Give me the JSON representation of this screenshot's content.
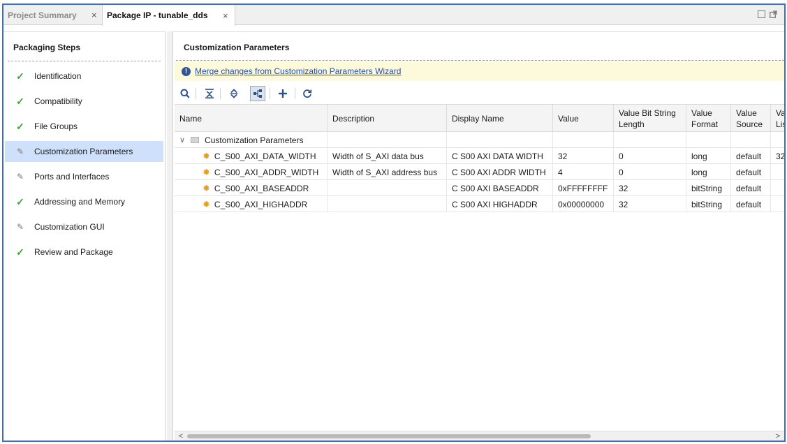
{
  "tabs": [
    {
      "label": "Project Summary",
      "close": "×"
    },
    {
      "label": "Package IP - tunable_dds",
      "close": "×"
    }
  ],
  "window_controls": {
    "maximize_icon": "maximize-icon",
    "float_icon": "float-icon"
  },
  "left_panel": {
    "title": "Packaging Steps",
    "steps": [
      {
        "label": "Identification",
        "status": "complete"
      },
      {
        "label": "Compatibility",
        "status": "complete"
      },
      {
        "label": "File Groups",
        "status": "complete"
      },
      {
        "label": "Customization Parameters",
        "status": "edited",
        "selected": true
      },
      {
        "label": "Ports and Interfaces",
        "status": "edited"
      },
      {
        "label": "Addressing and Memory",
        "status": "complete"
      },
      {
        "label": "Customization GUI",
        "status": "edited"
      },
      {
        "label": "Review and Package",
        "status": "complete"
      }
    ]
  },
  "main": {
    "title": "Customization Parameters",
    "banner_link": "Merge changes from Customization Parameters Wizard",
    "toolbar": [
      "search-icon",
      "collapse-all-icon",
      "expand-all-icon",
      "hierarchy-icon",
      "add-icon",
      "refresh-icon"
    ],
    "table": {
      "columns": [
        "Name",
        "Description",
        "Display Name",
        "Value",
        "Value Bit String Length",
        "Value Format",
        "Value Source",
        "Va Lis"
      ],
      "group": "Customization Parameters",
      "rows": [
        [
          "C_S00_AXI_DATA_WIDTH",
          "Width of S_AXI data bus",
          "C S00 AXI DATA WIDTH",
          "32",
          "0",
          "long",
          "default",
          "32"
        ],
        [
          "C_S00_AXI_ADDR_WIDTH",
          "Width of S_AXI address bus",
          "C S00 AXI ADDR WIDTH",
          "4",
          "0",
          "long",
          "default",
          ""
        ],
        [
          "C_S00_AXI_BASEADDR",
          "",
          "C S00 AXI BASEADDR",
          "0xFFFFFFFF",
          "32",
          "bitString",
          "default",
          ""
        ],
        [
          "C_S00_AXI_HIGHADDR",
          "",
          "C S00 AXI HIGHADDR",
          "0x00000000",
          "32",
          "bitString",
          "default",
          ""
        ]
      ]
    }
  },
  "colors": {
    "frame": "#3b6fc4",
    "selected": "#cfe0fb",
    "banner": "#fdfadb",
    "check": "#3aa235",
    "gear": "#e3a21a",
    "link": "#1f4fb5"
  }
}
